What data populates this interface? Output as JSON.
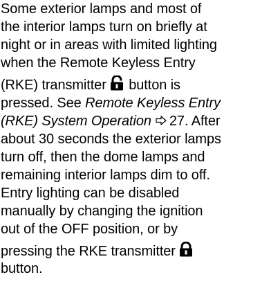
{
  "document": {
    "lines": {
      "l1": "Some exterior lamps and most of",
      "l2": "the interior lamps turn on briefly at",
      "l3": "night or in areas with limited lighting",
      "l4": "when the Remote Keyless Entry",
      "l5_before": "(RKE) transmitter",
      "l5_after": "button is",
      "l6_before": "pressed. See",
      "l6_link": "Remote Keyless Entry",
      "l7_link": "(RKE) System Operation",
      "l7_page": "27",
      "l7_after": ". After",
      "l8": "about 30 seconds the exterior lamps",
      "l9": "turn off, then the dome lamps and",
      "l10": "remaining interior lamps dim to off.",
      "l11": "Entry lighting can be disabled",
      "l12": "manually by changing the ignition",
      "l13": "out of the OFF position, or by",
      "l14_before": "pressing the RKE transmitter",
      "l15": "button."
    },
    "icons": {
      "unlock": "unlock-icon",
      "lock": "lock-icon",
      "page_ref": "page-reference-arrow-icon"
    }
  }
}
